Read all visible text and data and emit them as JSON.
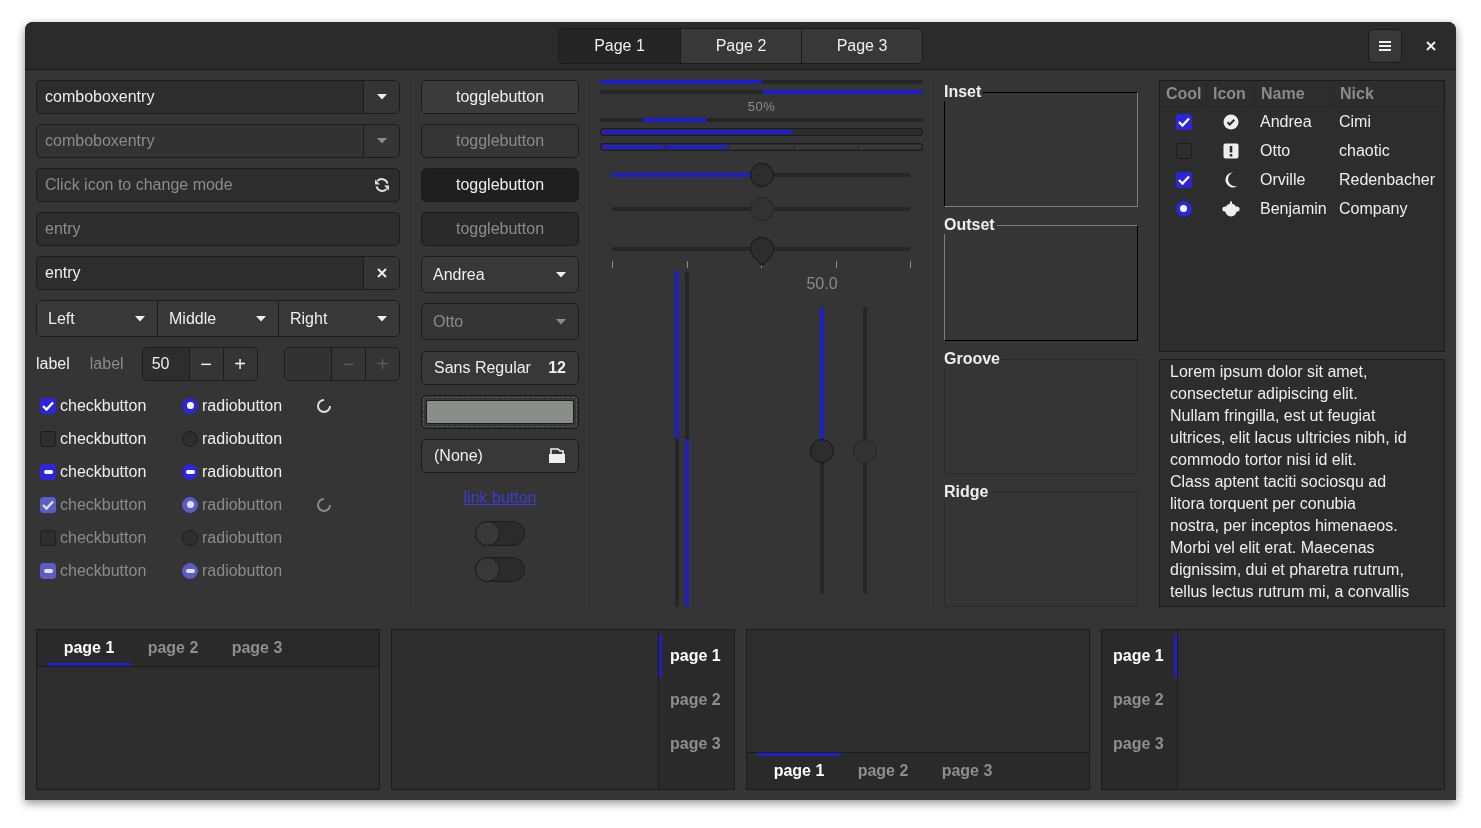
{
  "header": {
    "tabs": [
      {
        "label": "Page 1",
        "selected": true
      },
      {
        "label": "Page 2",
        "selected": false
      },
      {
        "label": "Page 3",
        "selected": false
      }
    ],
    "buttons": [
      {
        "kind": "menu"
      },
      {
        "kind": "close"
      }
    ]
  },
  "entries": [
    {
      "kind": "combo",
      "value": "comboboxentry",
      "disabled": false
    },
    {
      "kind": "combo",
      "value": "comboboxentry",
      "disabled": true
    },
    {
      "kind": "mode",
      "placeholder": "Click icon to change mode"
    },
    {
      "kind": "plain",
      "placeholder": "entry"
    },
    {
      "kind": "clear",
      "value": "entry"
    }
  ],
  "linked_combos": [
    {
      "label": "Left"
    },
    {
      "label": "Middle"
    },
    {
      "label": "Right"
    }
  ],
  "labels": [
    {
      "text": "label",
      "disabled": false
    },
    {
      "text": "label",
      "disabled": true
    }
  ],
  "spinbuttons": [
    {
      "value": "50",
      "minus": "−",
      "plus": "+",
      "disabled": false
    },
    {
      "minus": "−",
      "plus": "+",
      "disabled": true
    }
  ],
  "check_rows": [
    {
      "disabled": false,
      "spinner": true,
      "check": {
        "label": "checkbutton",
        "kind": "plain",
        "checked": true
      },
      "radio": {
        "label": "radiobutton",
        "kind": "plain",
        "checked": true
      }
    },
    {
      "disabled": false,
      "spinner": false,
      "check": {
        "label": "checkbutton",
        "kind": "plain",
        "checked": false
      },
      "radio": {
        "label": "radiobutton",
        "kind": "plain",
        "checked": false
      }
    },
    {
      "disabled": false,
      "spinner": false,
      "check": {
        "label": "checkbutton",
        "kind": "mixed",
        "checked": true
      },
      "radio": {
        "label": "radiobutton",
        "kind": "mixed",
        "checked": true
      }
    },
    {
      "disabled": true,
      "spinner": true,
      "check": {
        "label": "checkbutton",
        "kind": "plain",
        "checked": true
      },
      "radio": {
        "label": "radiobutton",
        "kind": "plain",
        "checked": true
      }
    },
    {
      "disabled": true,
      "spinner": false,
      "check": {
        "label": "checkbutton",
        "kind": "plain",
        "checked": false
      },
      "radio": {
        "label": "radiobutton",
        "kind": "plain",
        "checked": false
      }
    },
    {
      "disabled": true,
      "spinner": false,
      "check": {
        "label": "checkbutton",
        "kind": "mixed",
        "checked": true
      },
      "radio": {
        "label": "radiobutton",
        "kind": "mixed",
        "checked": true
      }
    }
  ],
  "toggle_buttons": [
    {
      "label": "togglebutton",
      "active": false,
      "disabled": false
    },
    {
      "label": "togglebutton",
      "active": false,
      "disabled": true
    },
    {
      "label": "togglebutton",
      "active": true,
      "disabled": false
    },
    {
      "label": "togglebutton",
      "active": true,
      "disabled": true
    }
  ],
  "combos": [
    {
      "value": "Andrea",
      "disabled": false
    },
    {
      "value": "Otto",
      "disabled": true
    }
  ],
  "font_button": {
    "name": "Sans Regular",
    "size": "12"
  },
  "color_button": {
    "color": "#8b8d89"
  },
  "file_button": {
    "label": "(None)"
  },
  "link_button": {
    "label": "link button"
  },
  "switches": [
    {
      "on": false
    },
    {
      "on": false
    }
  ],
  "progress_bars": [
    {
      "kind": "progress",
      "level": 0.5,
      "inverted": false
    },
    {
      "kind": "progress",
      "level": 0.5,
      "inverted": true
    },
    {
      "kind": "activity",
      "text": "50%",
      "level": 0.2
    },
    {
      "kind": "level",
      "level": 0.6
    },
    {
      "kind": "discrete",
      "level": 0.4
    }
  ],
  "scales": [
    {
      "level": 0.5,
      "fill": true,
      "disabled": false
    },
    {
      "level": 0.5,
      "fill": false,
      "disabled": true
    },
    {
      "level": 0.5,
      "fill": false,
      "marks": true,
      "disabled": false
    }
  ],
  "vertical_progress": [
    {
      "level": 0.5,
      "inverted": false
    },
    {
      "level": 0.5,
      "inverted": true
    }
  ],
  "vertical_scales": [
    {
      "level": 0.5,
      "value": "50.0",
      "fill": true,
      "disabled": false
    },
    {
      "level": 0.5,
      "fill": false,
      "disabled": true
    }
  ],
  "frames": [
    {
      "label": "Inset",
      "kind": "inset"
    },
    {
      "label": "Outset",
      "kind": "outset"
    },
    {
      "label": "Groove",
      "kind": "groove"
    },
    {
      "label": "Ridge",
      "kind": "ridge"
    }
  ],
  "tree": {
    "columns": [
      "Cool",
      "Icon",
      "Name",
      "Nick"
    ],
    "rows": [
      {
        "cool": {
          "kind": "check",
          "checked": true
        },
        "name": "Andrea",
        "nick": "Cimi"
      },
      {
        "cool": {
          "kind": "check",
          "checked": false
        },
        "name": "Otto",
        "nick": "chaotic"
      },
      {
        "cool": {
          "kind": "check",
          "checked": true
        },
        "name": "Orville",
        "nick": "Redenbacher"
      },
      {
        "cool": {
          "kind": "radio",
          "checked": true
        },
        "name": "Benjamin",
        "nick": "Company"
      }
    ]
  },
  "text_view": {
    "text": "Lorem ipsum dolor sit amet,\nconsectetur adipiscing elit.\nNullam fringilla, est ut feugiat\nultrices, elit lacus ultricies nibh, id\ncommodo tortor nisi id elit.\nClass aptent taciti sociosqu ad\nlitora torquent per conubia\nnostra, per inceptos himenaeos.\nMorbi vel elit erat. Maecenas\ndignissim, dui et pharetra rutrum,\ntellus lectus rutrum mi, a convallis"
  },
  "notebooks": [
    {
      "kind": "top",
      "tabs": [
        {
          "label": "page 1",
          "selected": true
        },
        {
          "label": "page 2",
          "selected": false
        },
        {
          "label": "page 3",
          "selected": false
        }
      ]
    },
    {
      "kind": "right",
      "tabs": [
        {
          "label": "page 1",
          "selected": true
        },
        {
          "label": "page 2",
          "selected": false
        },
        {
          "label": "page 3",
          "selected": false
        }
      ]
    },
    {
      "kind": "bottom",
      "tabs": [
        {
          "label": "page 1",
          "selected": true
        },
        {
          "label": "page 2",
          "selected": false
        },
        {
          "label": "page 3",
          "selected": false
        }
      ]
    },
    {
      "kind": "left",
      "tabs": [
        {
          "label": "page 1",
          "selected": true
        },
        {
          "label": "page 2",
          "selected": false
        },
        {
          "label": "page 3",
          "selected": false
        }
      ]
    }
  ]
}
